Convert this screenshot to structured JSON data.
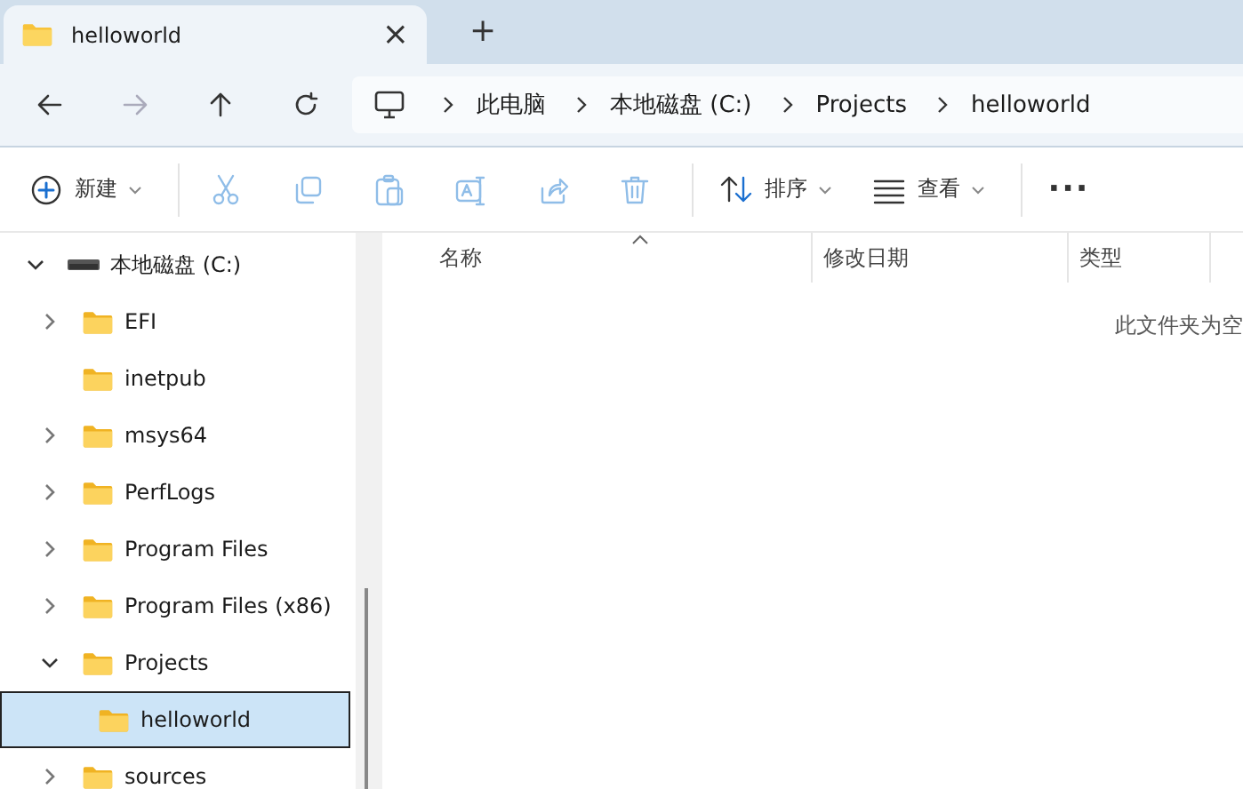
{
  "tab": {
    "title": "helloworld",
    "close": "×"
  },
  "new_tab": "+",
  "nav": [
    {
      "kind": "back",
      "disabled": false
    },
    {
      "kind": "forward",
      "disabled": true
    },
    {
      "kind": "up",
      "disabled": false
    },
    {
      "kind": "refresh",
      "disabled": false
    }
  ],
  "breadcrumb": [
    "此电脑",
    "本地磁盘 (C:)",
    "Projects",
    "helloworld"
  ],
  "toolbar": [
    {
      "kind": "new",
      "label": "新建",
      "disabled": false
    },
    {
      "kind": "cut",
      "disabled": true
    },
    {
      "kind": "copy",
      "disabled": true
    },
    {
      "kind": "paste",
      "disabled": true
    },
    {
      "kind": "rename",
      "disabled": true
    },
    {
      "kind": "share",
      "disabled": true
    },
    {
      "kind": "delete",
      "disabled": true
    },
    {
      "kind": "sort",
      "label": "排序",
      "disabled": false
    },
    {
      "kind": "view",
      "label": "查看",
      "disabled": false
    },
    {
      "kind": "more",
      "label": "···",
      "disabled": false
    }
  ],
  "tree": [
    {
      "label": "本地磁盘 (C:)",
      "kind": "drive",
      "expandable": true,
      "expanded": true,
      "selected": false,
      "children": [
        {
          "label": "EFI",
          "kind": "folder",
          "expandable": true,
          "expanded": false,
          "selected": false
        },
        {
          "label": "inetpub",
          "kind": "folder",
          "expandable": false,
          "expanded": false,
          "selected": false
        },
        {
          "label": "msys64",
          "kind": "folder",
          "expandable": true,
          "expanded": false,
          "selected": false
        },
        {
          "label": "PerfLogs",
          "kind": "folder",
          "expandable": true,
          "expanded": false,
          "selected": false
        },
        {
          "label": "Program Files",
          "kind": "folder",
          "expandable": true,
          "expanded": false,
          "selected": false
        },
        {
          "label": "Program Files (x86)",
          "kind": "folder",
          "expandable": true,
          "expanded": false,
          "selected": false
        },
        {
          "label": "Projects",
          "kind": "folder",
          "expandable": true,
          "expanded": true,
          "selected": false,
          "children": [
            {
              "label": "helloworld",
              "kind": "folder",
              "expandable": false,
              "expanded": false,
              "selected": true
            }
          ]
        },
        {
          "label": "sources",
          "kind": "folder",
          "expandable": true,
          "expanded": false,
          "selected": false
        }
      ]
    }
  ],
  "columns": [
    {
      "label": "名称",
      "sorted": true
    },
    {
      "label": "修改日期",
      "sorted": false
    },
    {
      "label": "类型",
      "sorted": false
    }
  ],
  "empty_message": "此文件夹为空"
}
